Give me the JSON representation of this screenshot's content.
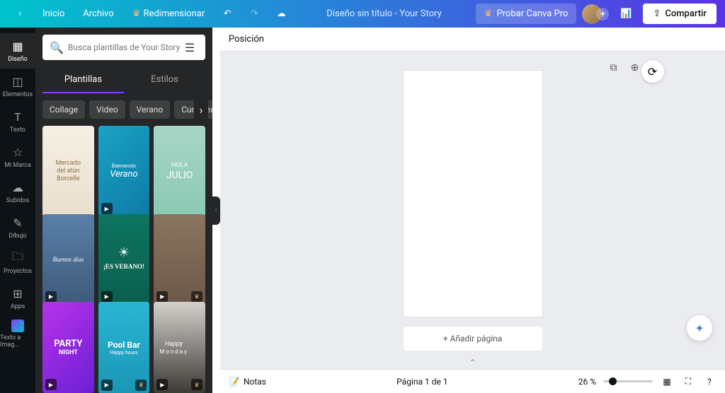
{
  "topbar": {
    "home": "Inicio",
    "file": "Archivo",
    "resize": "Redimensionar",
    "doc_title": "Diseño sin título - Your Story",
    "try_pro": "Probar Canva Pro",
    "share": "Compartir"
  },
  "rail": {
    "design": "Diseño",
    "elements": "Elementos",
    "text": "Texto",
    "brand": "Mi Marca",
    "uploads": "Subidos",
    "draw": "Dibujo",
    "projects": "Proyectos",
    "apps": "Apps",
    "text_to_image": "Texto a Imag..."
  },
  "panel": {
    "search_placeholder": "Busca plantillas de Your Story",
    "tab_templates": "Plantillas",
    "tab_styles": "Estilos",
    "chips": {
      "collage": "Collage",
      "video": "Video",
      "verano": "Verano",
      "cumple": "Cumpleaños"
    },
    "cards": {
      "c1a": "Mercado",
      "c1b": "del atún",
      "c1c": "Borcelle",
      "c2a": "Bienvenido",
      "c2b": "Verano",
      "c3a": "HOLA",
      "c3b": "JULIO",
      "c4a": "Buenos días",
      "c5a": "¡ES VERANO!",
      "c7a": "PARTY",
      "c7b": "NIGHT",
      "c8a": "Pool Bar",
      "c8b": "Happy hours",
      "c9a": "Happy",
      "c9b": "Monday"
    }
  },
  "canvas": {
    "position": "Posición",
    "add_page": "+ Añadir página"
  },
  "bottom": {
    "notes": "Notas",
    "page_indicator": "Página 1 de 1",
    "zoom": "26 %"
  }
}
